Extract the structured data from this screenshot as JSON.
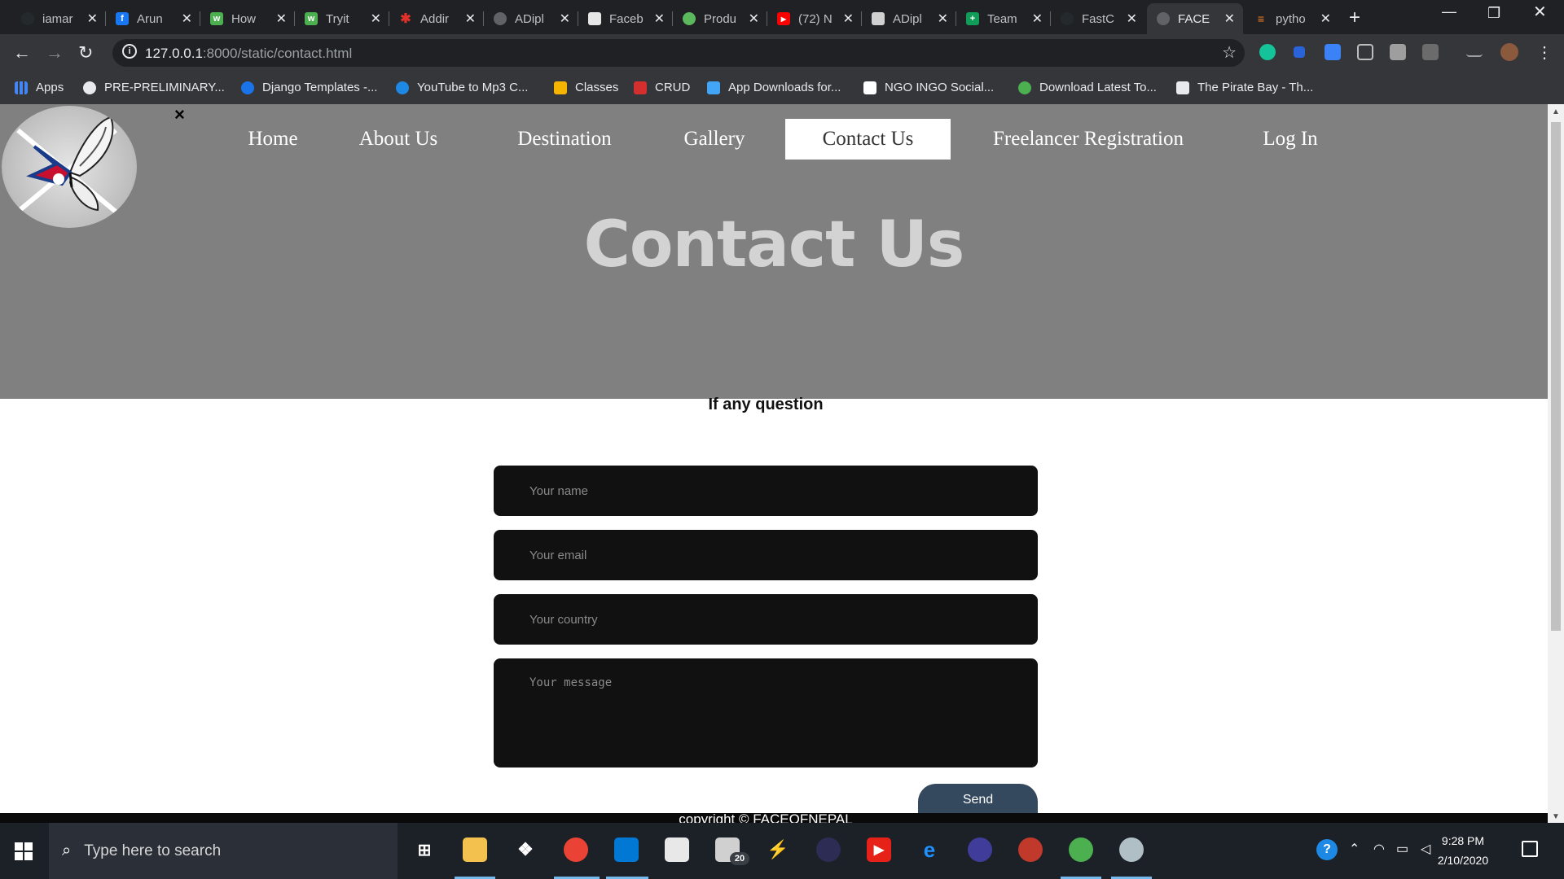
{
  "browser": {
    "tabs": [
      {
        "title": "iamar",
        "icon": "github-icon",
        "color": "#24292e"
      },
      {
        "title": "Arun",
        "icon": "facebook-icon",
        "color": "#1877f2"
      },
      {
        "title": "How",
        "icon": "w3schools-icon",
        "color": "#4caf50"
      },
      {
        "title": "Tryit",
        "icon": "w3schools-icon",
        "color": "#4caf50"
      },
      {
        "title": "Addir",
        "icon": "gear-red-icon",
        "color": "#e0312b"
      },
      {
        "title": "ADipl",
        "icon": "globe-icon",
        "color": "#5f6368"
      },
      {
        "title": "Faceb",
        "icon": "store-icon",
        "color": "#e6e6e6"
      },
      {
        "title": "Produ",
        "icon": "green-leaf-icon",
        "color": "#5cb85c"
      },
      {
        "title": "(72) N",
        "icon": "youtube-icon",
        "color": "#ff0000"
      },
      {
        "title": "ADipl",
        "icon": "portrait-icon",
        "color": "#d0d0d0"
      },
      {
        "title": "Team",
        "icon": "green-plus-icon",
        "color": "#0f9d58"
      },
      {
        "title": "FastC",
        "icon": "github-icon",
        "color": "#24292e"
      },
      {
        "title": "FACE",
        "icon": "globe-icon",
        "color": "#5f6368"
      },
      {
        "title": "pytho",
        "icon": "stackoverflow-icon",
        "color": "#f48024"
      }
    ],
    "url_host": "127.0.0.1",
    "url_rest": ":8000/static/contact.html",
    "bookmarks": [
      {
        "label": "Apps",
        "icon": "apps-grid-icon"
      },
      {
        "label": "PRE-PRELIMINARY...",
        "icon": "globe-icon"
      },
      {
        "label": "Django Templates -...",
        "icon": "django-icon"
      },
      {
        "label": "YouTube to Mp3 C...",
        "icon": "download-cloud-icon"
      },
      {
        "label": "Classes",
        "icon": "classroom-icon"
      },
      {
        "label": "CRUD",
        "icon": "crud-icon"
      },
      {
        "label": "App Downloads for...",
        "icon": "download-icon"
      },
      {
        "label": "NGO INGO Social...",
        "icon": "in-icon"
      },
      {
        "label": "Download Latest To...",
        "icon": "utorrent-icon"
      },
      {
        "label": "The Pirate Bay - Th...",
        "icon": "monitor-icon"
      }
    ]
  },
  "site": {
    "nav": [
      {
        "label": "Home",
        "active": false
      },
      {
        "label": "About Us",
        "active": false
      },
      {
        "label": "Destination",
        "active": false
      },
      {
        "label": "Gallery",
        "active": false
      },
      {
        "label": "Contact Us",
        "active": true
      },
      {
        "label": "Freelancer Registration",
        "active": false
      },
      {
        "label": "Log In",
        "active": false
      }
    ],
    "close_symbol": "×",
    "hero_title": "Contact Us",
    "subheading": "If any question",
    "form": {
      "name_placeholder": "Your name",
      "email_placeholder": "Your email",
      "country_placeholder": "Your country",
      "message_placeholder": "Your message",
      "send_label": "Send"
    },
    "footer": "copyright © FACEOFNEPAL"
  },
  "taskbar": {
    "search_placeholder": "Type here to search",
    "mail_badge": "20",
    "time": "9:28 PM",
    "date": "2/10/2020"
  },
  "colors": {
    "hero_bg": "#808080",
    "field_bg": "#111111",
    "send_bg": "#34495e",
    "footer_bg": "#0a0a0a"
  }
}
